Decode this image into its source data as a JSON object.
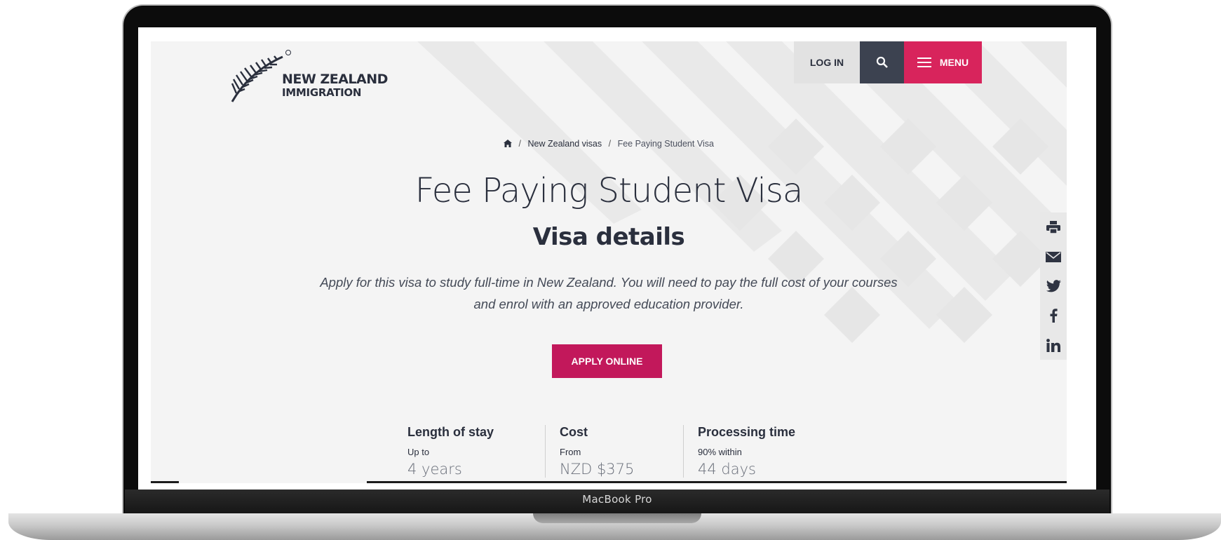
{
  "device": {
    "model_label": "MacBook Pro"
  },
  "logo": {
    "line1": "NEW ZEALAND",
    "line2": "IMMIGRATION",
    "icon": "silver-fern-icon"
  },
  "nav": {
    "login_label": "LOG IN",
    "search_icon": "search-icon",
    "menu_label": "MENU",
    "menu_icon": "hamburger-icon"
  },
  "breadcrumb": {
    "home_icon": "home-icon",
    "items": [
      "New Zealand visas",
      "Fee Paying Student Visa"
    ],
    "separator": "/"
  },
  "hero": {
    "title": "Fee Paying Student Visa",
    "subtitle": "Visa details",
    "intro": "Apply for this visa to study full-time in New Zealand. You will need to pay the full cost of your courses and enrol with an approved education provider.",
    "cta_label": "APPLY ONLINE"
  },
  "facts": [
    {
      "label": "Length of stay",
      "sub": "Up to",
      "value": "4 years"
    },
    {
      "label": "Cost",
      "sub": "From",
      "value": "NZD $375"
    },
    {
      "label": "Processing time",
      "sub": "90% within",
      "value": "44 days"
    }
  ],
  "share": [
    "print-icon",
    "email-icon",
    "twitter-icon",
    "facebook-icon",
    "linkedin-icon"
  ],
  "colors": {
    "brand_dark": "#2a2f3d",
    "menu_pink": "#d8245c",
    "cta_crimson": "#c2185b",
    "search_bg": "#3c4250",
    "page_bg": "#f4f4f4"
  }
}
